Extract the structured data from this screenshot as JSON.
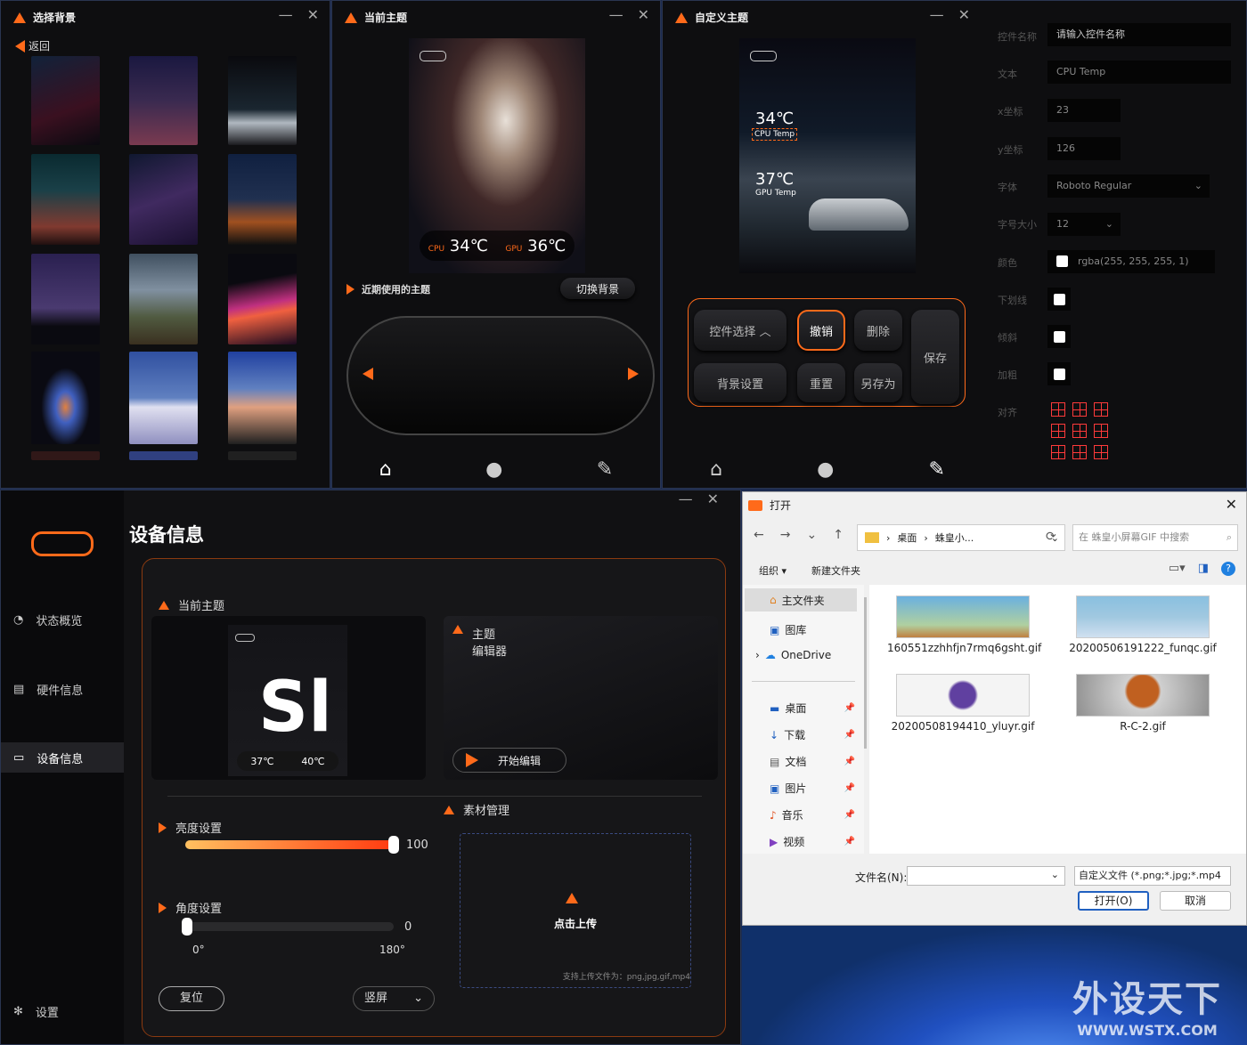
{
  "window_bg": {
    "title": "选择背景",
    "back": "返回"
  },
  "window_theme": {
    "title": "当前主题",
    "cpu_label": "CPU",
    "cpu_temp": "34℃",
    "gpu_label": "GPU",
    "gpu_temp": "36℃",
    "recent": "近期使用的主题",
    "switch_bg": "切换背景"
  },
  "window_custom": {
    "title": "自定义主题",
    "preview_cpu": "34℃",
    "preview_cpu_label": "CPU Temp",
    "preview_gpu": "37℃",
    "preview_gpu_label": "GPU Temp",
    "buttons": {
      "control_select": "控件选择",
      "undo": "撤销",
      "delete": "删除",
      "save": "保存",
      "bg_settings": "背景设置",
      "reset": "重置",
      "save_as": "另存为"
    },
    "props": {
      "name_label": "控件名称",
      "name_placeholder": "请输入控件名称",
      "text_label": "文本",
      "text_value": "CPU Temp",
      "x_label": "x坐标",
      "x_value": "23",
      "y_label": "y坐标",
      "y_value": "126",
      "font_label": "字体",
      "font_value": "Roboto Regular",
      "size_label": "字号大小",
      "size_value": "12",
      "color_label": "颜色",
      "color_value": "rgba(255, 255, 255, 1)",
      "underline_label": "下划线",
      "italic_label": "倾斜",
      "bold_label": "加粗",
      "align_label": "对齐"
    }
  },
  "window_device": {
    "sidebar": [
      "状态概览",
      "硬件信息",
      "设备信息"
    ],
    "settings": "设置",
    "title": "设备信息",
    "current_theme": "当前主题",
    "editor_title_1": "主题",
    "editor_title_2": "编辑器",
    "start_edit": "开始编辑",
    "thumb_cpu": "37℃",
    "thumb_gpu": "40℃",
    "material": "素材管理",
    "brightness": "亮度设置",
    "brightness_value": "100",
    "brightness_level": 1.0,
    "angle": "角度设置",
    "angle_value": "0",
    "angle_min": "0°",
    "angle_max": "180°",
    "upload": "点击上传",
    "upload_hint": "支持上传文件为：png,jpg,gif,mp4",
    "reset": "复位",
    "orientation": "竖屏"
  },
  "file_dialog": {
    "title": "打开",
    "path_1": "桌面",
    "path_2": "蛛皇小...",
    "search_placeholder": "在 蛛皇小屏幕GIF 中搜索",
    "organize": "组织 ▾",
    "new_folder": "新建文件夹",
    "nav": [
      "主文件夹",
      "图库",
      "OneDrive"
    ],
    "quick": [
      "桌面",
      "下载",
      "文档",
      "图片",
      "音乐",
      "视频"
    ],
    "files": [
      "160551zzhhfjn7rmq6gsht.gif",
      "20200506191222_funqc.gif",
      "20200508194410_yluyr.gif",
      "R-C-2.gif"
    ],
    "filename_label": "文件名(N):",
    "filter": "自定义文件 (*.png;*.jpg;*.mp4",
    "open": "打开(O)",
    "cancel": "取消"
  },
  "watermark": {
    "cn": "外设天下",
    "en": "WWW.WSTX.COM"
  }
}
